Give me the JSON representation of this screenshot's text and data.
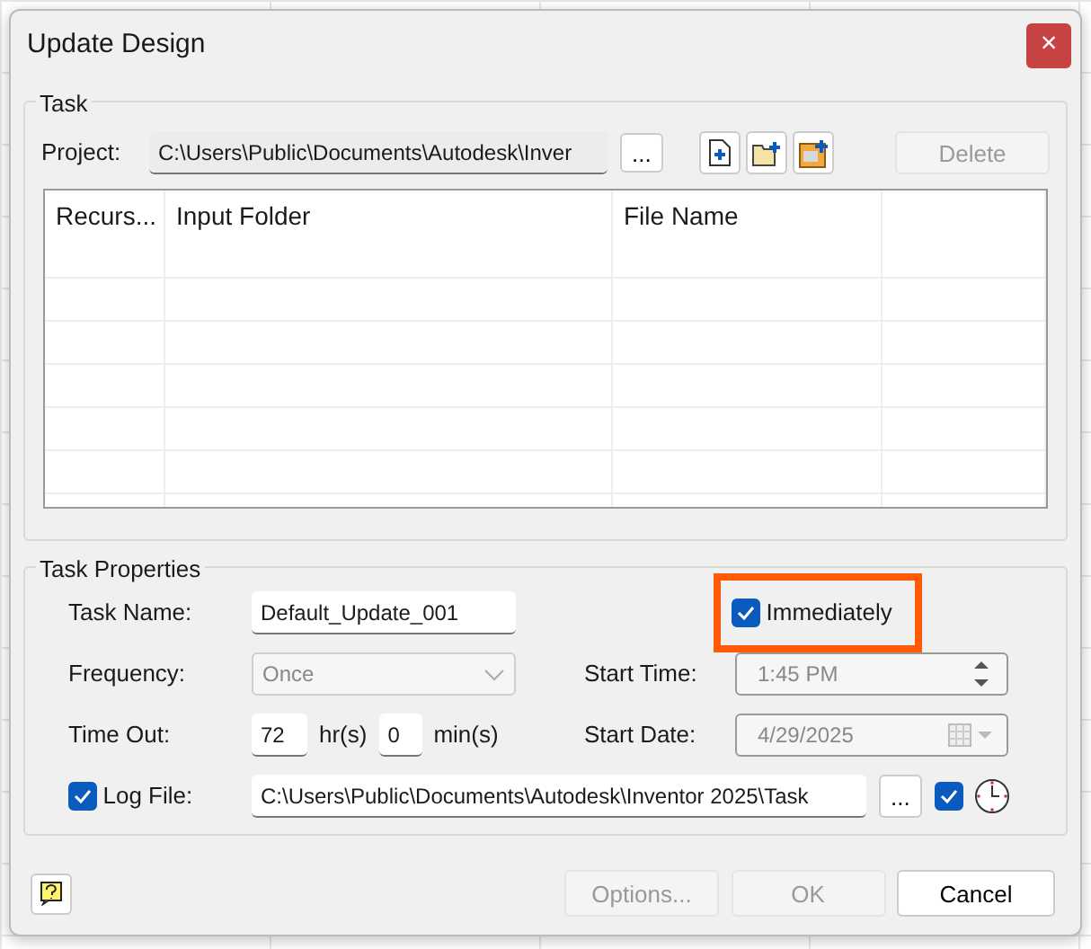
{
  "window": {
    "title": "Update Design",
    "close": "×"
  },
  "task": {
    "legend": "Task",
    "project_label": "Project:",
    "project_path": "C:\\Users\\Public\\Documents\\Autodesk\\Inver",
    "browse": "...",
    "delete": {
      "label": "Delete",
      "disabled": true
    },
    "table": {
      "columns": [
        "Recurs...",
        "Input Folder",
        "File Name"
      ]
    }
  },
  "properties": {
    "legend": "Task Properties",
    "task_name": {
      "label": "Task Name:",
      "value": "Default_Update_001"
    },
    "immediately": {
      "label": "Immediately",
      "checked": true,
      "highlighted": true
    },
    "frequency": {
      "label": "Frequency:",
      "value": "Once",
      "disabled": true
    },
    "start_time": {
      "label": "Start Time:",
      "value": "1:45 PM",
      "disabled": true
    },
    "time_out": {
      "label": "Time Out:",
      "hours": "72",
      "hours_unit": "hr(s)",
      "minutes": "0",
      "minutes_unit": "min(s)"
    },
    "start_date": {
      "label": "Start Date:",
      "value": "4/29/2025",
      "disabled": true
    },
    "log_file": {
      "label": "Log File:",
      "checked": true,
      "path": "C:\\Users\\Public\\Documents\\Autodesk\\Inventor 2025\\Task",
      "browse": "...",
      "schedule_checked": true
    }
  },
  "buttons": [
    {
      "label": "Options...",
      "disabled": true
    },
    {
      "label": "OK",
      "disabled": true
    },
    {
      "label": "Cancel",
      "disabled": false
    }
  ]
}
